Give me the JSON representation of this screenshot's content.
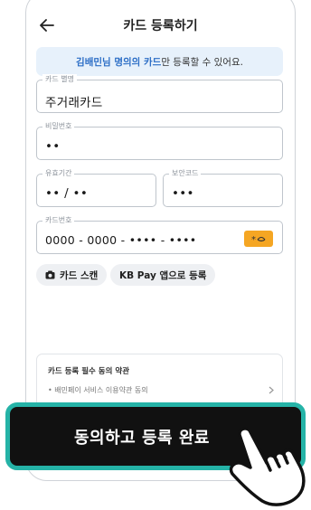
{
  "header": {
    "title": "카드 등록하기",
    "back_icon": "arrow-left-icon"
  },
  "notice": {
    "highlight": "김배민님 명의의 카드",
    "text": "만 등록할 수 있어요."
  },
  "form": {
    "card_name": {
      "label": "카드 별명",
      "value": "주거래카드"
    },
    "password": {
      "label": "비밀번호",
      "value": "••"
    },
    "expiry": {
      "label": "유효기간",
      "value": "•• / ••"
    },
    "cvc": {
      "label": "보안코드",
      "value": "•••"
    },
    "card_number": {
      "label": "카드번호",
      "value": "0000 - 0000 - •••• - ••••",
      "toggle_icon": "masked-eye-icon"
    }
  },
  "chips": {
    "scan": {
      "label": "카드 스캔",
      "icon": "camera-icon"
    },
    "kb_pay": {
      "label": "KB Pay 앱으로 등록"
    }
  },
  "terms": {
    "title": "카드 등록 필수 동의 약관",
    "item": "• 배민페이 서비스 이용약관 동의"
  },
  "cta": {
    "label": "동의하고 등록 완료"
  },
  "colors": {
    "accent_border": "#25b3a7",
    "notice_bg": "#e7f1fb",
    "highlight_text": "#2c6ec6",
    "toggle_bg": "#f5a623",
    "button_bg": "#111111"
  }
}
